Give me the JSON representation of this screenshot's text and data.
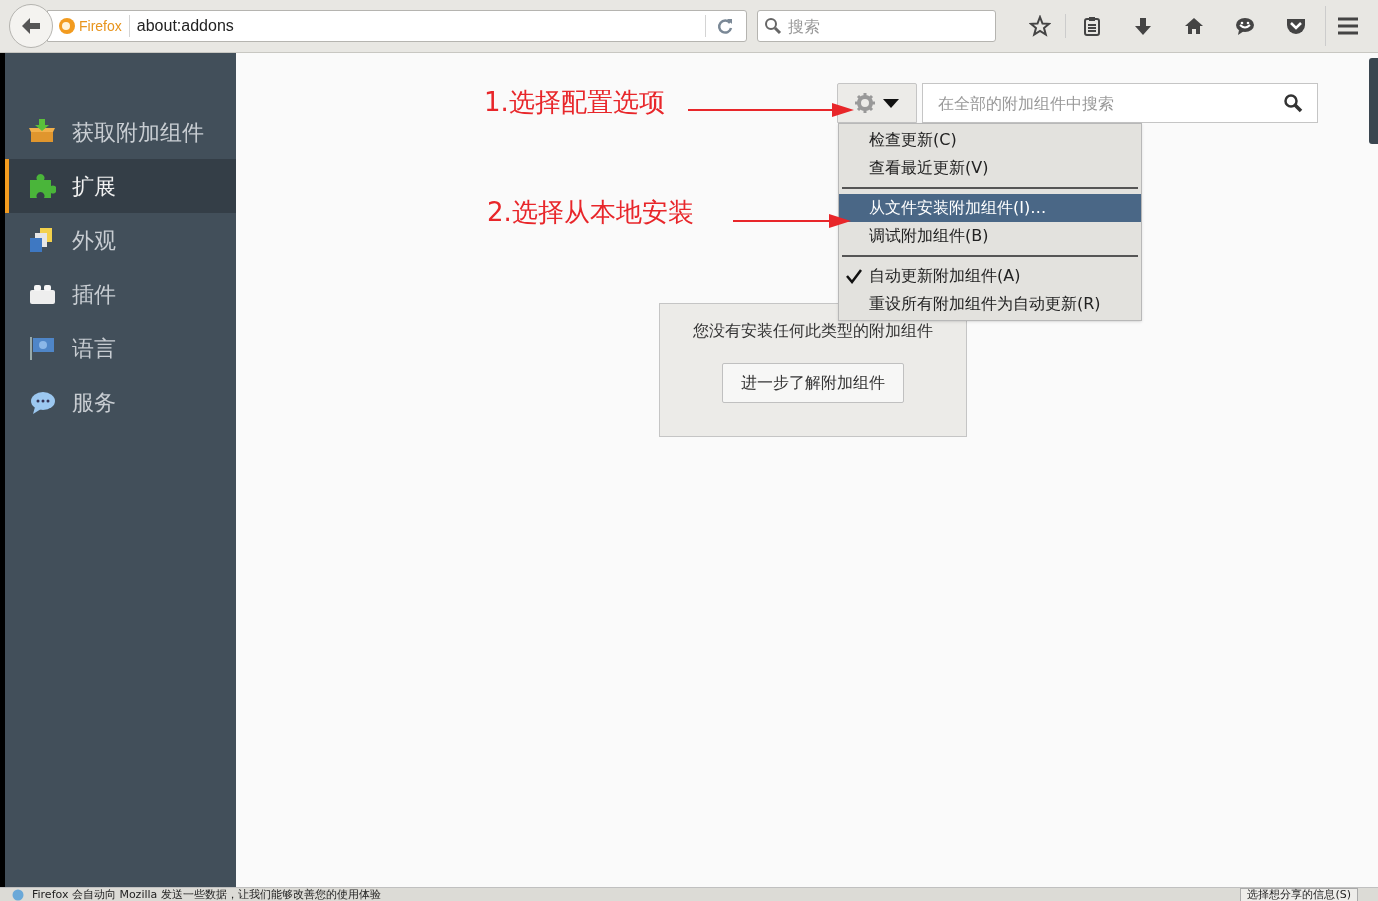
{
  "toolbar": {
    "identity_label": "Firefox",
    "url": "about:addons",
    "search_placeholder": "搜索"
  },
  "sidebar": {
    "items": [
      {
        "label": "获取附加组件",
        "selected": false
      },
      {
        "label": "扩展",
        "selected": true
      },
      {
        "label": "外观",
        "selected": false
      },
      {
        "label": "插件",
        "selected": false
      },
      {
        "label": "语言",
        "selected": false
      },
      {
        "label": "服务",
        "selected": false
      }
    ]
  },
  "addon_search": {
    "placeholder": "在全部的附加组件中搜索"
  },
  "tools_menu": {
    "expanded": true,
    "items": [
      {
        "kind": "item",
        "label": "检查更新(C)",
        "selected": false,
        "checked": false
      },
      {
        "kind": "item",
        "label": "查看最近更新(V)",
        "selected": false,
        "checked": false
      },
      {
        "kind": "separator"
      },
      {
        "kind": "item",
        "label": "从文件安装附加组件(I)…",
        "selected": true,
        "checked": false
      },
      {
        "kind": "item",
        "label": "调试附加组件(B)",
        "selected": false,
        "checked": false
      },
      {
        "kind": "separator"
      },
      {
        "kind": "item",
        "label": "自动更新附加组件(A)",
        "selected": false,
        "checked": true
      },
      {
        "kind": "item",
        "label": "重设所有附加组件为自动更新(R)",
        "selected": false,
        "checked": false
      }
    ]
  },
  "empty_notice": {
    "message": "您没有安装任何此类型的附加组件",
    "button": "进一步了解附加组件"
  },
  "annotations": [
    {
      "text": "1.选择配置选项"
    },
    {
      "text": "2.选择从本地安装"
    }
  ],
  "notification_bar": {
    "message": "Firefox 会自动向 Mozilla 发送一些数据，让我们能够改善您的使用体验",
    "button": "选择想分享的信息(S)"
  }
}
